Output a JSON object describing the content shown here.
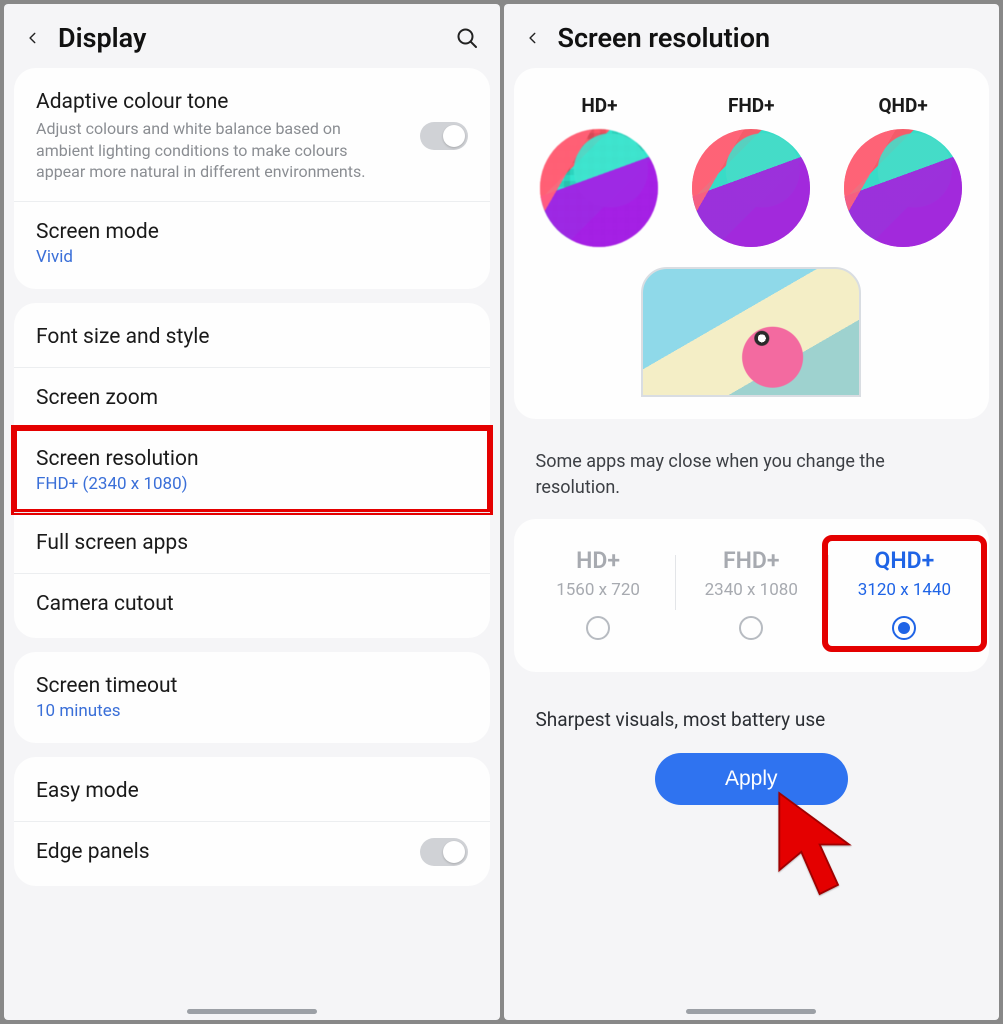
{
  "left": {
    "title": "Display",
    "adaptive": {
      "title": "Adaptive colour tone",
      "desc": "Adjust colours and white balance based on ambient lighting conditions to make colours appear more natural in different environments."
    },
    "screen_mode": {
      "title": "Screen mode",
      "value": "Vivid"
    },
    "font": {
      "title": "Font size and style"
    },
    "zoom": {
      "title": "Screen zoom"
    },
    "resolution": {
      "title": "Screen resolution",
      "value": "FHD+ (2340 x 1080)"
    },
    "fullscreen": {
      "title": "Full screen apps"
    },
    "cutout": {
      "title": "Camera cutout"
    },
    "timeout": {
      "title": "Screen timeout",
      "value": "10 minutes"
    },
    "easy": {
      "title": "Easy mode"
    },
    "edge": {
      "title": "Edge panels"
    }
  },
  "right": {
    "title": "Screen resolution",
    "previews": [
      {
        "label": "HD+"
      },
      {
        "label": "FHD+"
      },
      {
        "label": "QHD+"
      }
    ],
    "note": "Some apps may close when you change the resolution.",
    "options": [
      {
        "name": "HD+",
        "res": "1560 x 720",
        "selected": false
      },
      {
        "name": "FHD+",
        "res": "2340 x 1080",
        "selected": false
      },
      {
        "name": "QHD+",
        "res": "3120 x 1440",
        "selected": true
      }
    ],
    "selected_desc": "Sharpest visuals, most battery use",
    "apply": "Apply"
  }
}
